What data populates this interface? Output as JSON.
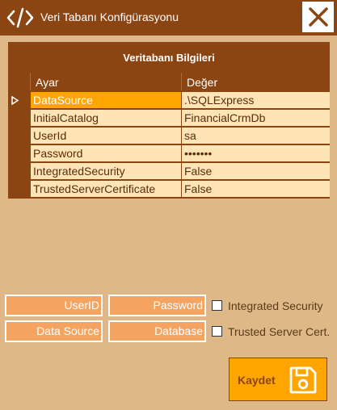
{
  "window": {
    "title": "Veri Tabanı Konfigürasyonu",
    "app_icon": "code-icon",
    "close_icon": "close-icon"
  },
  "colors": {
    "title_bar": "#8B4513",
    "background": "#DEB887",
    "cell_background": "#FFE4B5",
    "selected_cell": "#FFA500",
    "input_background": "#F4A460",
    "save_button": "#FFA500"
  },
  "grid": {
    "caption": "Veritabanı Bilgileri",
    "columns": [
      "Ayar",
      "Değer"
    ],
    "selected_row": 0,
    "rows": [
      {
        "key": "DataSource",
        "value": ".\\SQLExpress"
      },
      {
        "key": "InitialCatalog",
        "value": "FinancialCrmDb"
      },
      {
        "key": "UserId",
        "value": "sa"
      },
      {
        "key": "Password",
        "value": "•••••••"
      },
      {
        "key": "IntegratedSecurity",
        "value": "False"
      },
      {
        "key": "TrustedServerCertificate",
        "value": "False"
      }
    ]
  },
  "form": {
    "userid_placeholder": "UserID",
    "password_placeholder": "Password",
    "datasource_placeholder": "Data Source",
    "database_placeholder": "Database",
    "integrated_security_label": "Integrated Security",
    "integrated_security_checked": false,
    "trusted_cert_label": "Trusted Server Cert.",
    "trusted_cert_checked": false
  },
  "save": {
    "label": "Kaydet",
    "icon": "save-icon"
  }
}
